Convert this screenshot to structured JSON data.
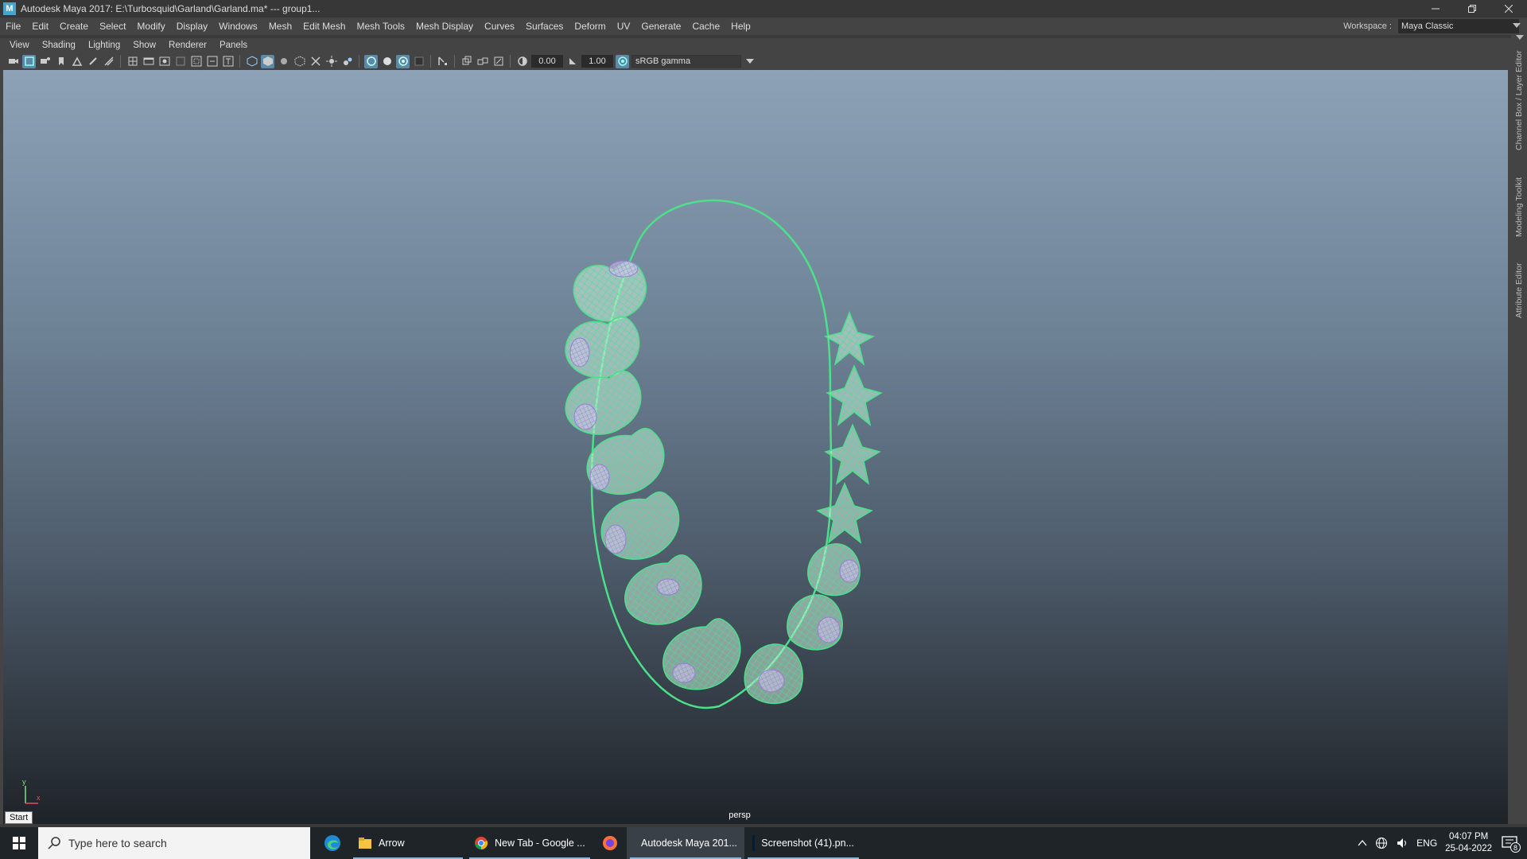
{
  "window": {
    "title": "Autodesk Maya 2017: E:\\Turbosquid\\Garland\\Garland.ma*   ---   group1...",
    "app_icon_letter": "M",
    "controls": [
      "minimize-icon",
      "restore-icon",
      "close-icon"
    ]
  },
  "menubar": {
    "items": [
      "File",
      "Edit",
      "Create",
      "Select",
      "Modify",
      "Display",
      "Windows",
      "Mesh",
      "Edit Mesh",
      "Mesh Tools",
      "Mesh Display",
      "Curves",
      "Surfaces",
      "Deform",
      "UV",
      "Generate",
      "Cache",
      "Help"
    ],
    "workspace_label": "Workspace :",
    "workspace_value": "Maya Classic"
  },
  "panel_menu": {
    "items": [
      "View",
      "Shading",
      "Lighting",
      "Show",
      "Renderer",
      "Panels"
    ]
  },
  "viewport_toolbar": {
    "icons": [
      "select-camera-icon",
      "camera-attributes-icon",
      "bookmark-icon",
      "image-plane-icon",
      "2d-pan-zoom-icon",
      "grease-pencil-icon",
      "grid-icon",
      "film-gate-icon",
      "resolution-gate-icon",
      "gate-mask-icon",
      "field-chart-icon",
      "safe-action-icon",
      "safe-title-icon",
      "wireframe-icon",
      "smooth-shade-icon",
      "default-lighting-icon",
      "textured-icon",
      "use-all-lights-icon",
      "shadows-icon",
      "screen-space-ao-icon",
      "motion-blur-icon",
      "anti-aliasing-icon",
      "depth-of-field-icon",
      "isolate-select-icon",
      "xray-icon",
      "xray-joints-icon",
      "xray-components-icon",
      "exposure-icon",
      "gamma-icon",
      "color-management-icon"
    ],
    "exposure_value": "0.00",
    "gamma_value": "1.00",
    "color_space": "sRGB gamma"
  },
  "viewport": {
    "camera_label": "persp",
    "axis_y": "y",
    "axis_x": "x",
    "start_tooltip": "Start",
    "colors": {
      "wireframe": "#4de08a",
      "highlight": "#b89ae0",
      "gradient_top": "#8da2b6",
      "gradient_bottom": "#1e2328"
    }
  },
  "right_dock": {
    "tabs": [
      "Channel Box / Layer Editor",
      "Modeling Toolkit",
      "Attribute Editor"
    ]
  },
  "taskbar": {
    "search_placeholder": "Type here to search",
    "apps": [
      {
        "label": "",
        "icon": "edge-icon"
      },
      {
        "label": "Arrow",
        "icon": "file-explorer-icon"
      },
      {
        "label": "New Tab - Google ...",
        "icon": "chrome-icon"
      },
      {
        "label": "",
        "icon": "firefox-icon"
      },
      {
        "label": "Autodesk Maya 201...",
        "icon": "maya-icon"
      },
      {
        "label": "Screenshot (41).pn...",
        "icon": "photoshop-icon"
      }
    ],
    "tray": {
      "language": "ENG",
      "time": "04:07 PM",
      "date": "25-04-2022",
      "notification_count": "8"
    }
  }
}
